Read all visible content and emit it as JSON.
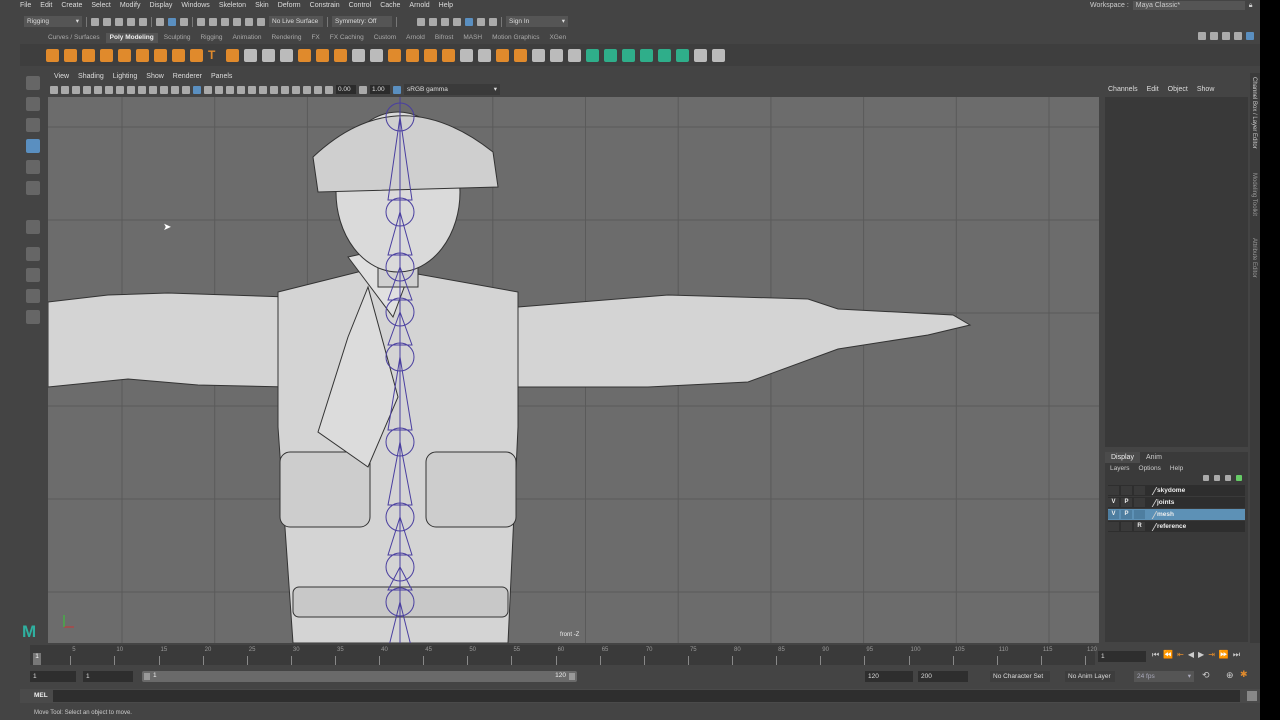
{
  "menubar": [
    "File",
    "Edit",
    "Create",
    "Select",
    "Modify",
    "Display",
    "Windows",
    "Skeleton",
    "Skin",
    "Deform",
    "Constrain",
    "Control",
    "Cache",
    "Arnold",
    "Help"
  ],
  "workspace": {
    "label": "Workspace :",
    "value": "Maya Classic*"
  },
  "status": {
    "menuset": "Rigging",
    "live_surface": "No Live Surface",
    "symmetry": "Symmetry: Off",
    "sign_in": "Sign In"
  },
  "shelf_tabs": [
    "Curves / Surfaces",
    "Poly Modeling",
    "Sculpting",
    "Rigging",
    "Animation",
    "Rendering",
    "FX",
    "FX Caching",
    "Custom",
    "Arnold",
    "Bifrost",
    "MASH",
    "Motion Graphics",
    "XGen"
  ],
  "viewport": {
    "menu": [
      "View",
      "Shading",
      "Lighting",
      "Show",
      "Renderer",
      "Panels"
    ],
    "exposure": "0.00",
    "gamma": "1.00",
    "colorspace": "sRGB gamma",
    "camera_label": "front -Z"
  },
  "channel_box": {
    "menu": [
      "Channels",
      "Edit",
      "Object",
      "Show"
    ]
  },
  "layer_editor": {
    "tabs": [
      "Display",
      "Anim"
    ],
    "menu": [
      "Layers",
      "Options",
      "Help"
    ],
    "layers": [
      {
        "v": "",
        "p": "",
        "r": "",
        "name": "skydome"
      },
      {
        "v": "V",
        "p": "P",
        "r": "",
        "name": "joints"
      },
      {
        "v": "V",
        "p": "P",
        "r": "",
        "name": "mesh"
      },
      {
        "v": "",
        "p": "",
        "r": "R",
        "name": "reference"
      }
    ]
  },
  "side_tabs": [
    "Channel Box / Layer Editor",
    "Modeling Toolkit",
    "Attribute Editor"
  ],
  "timeline": {
    "ticks": [
      "1",
      "5",
      "10",
      "15",
      "20",
      "25",
      "30",
      "35",
      "40",
      "45",
      "50",
      "55",
      "60",
      "65",
      "70",
      "75",
      "80",
      "85",
      "90",
      "95",
      "100",
      "105",
      "110",
      "115",
      "120"
    ],
    "current_frame": "1"
  },
  "range": {
    "start": "1",
    "playback_start": "1",
    "slider_start": "1",
    "slider_end": "120",
    "playback_end": "120",
    "end": "200",
    "character_set": "No Character Set",
    "anim_layer": "No Anim Layer",
    "fps": "24 fps"
  },
  "command": {
    "lang": "MEL"
  },
  "help_line": "Move Tool: Select an object to move."
}
